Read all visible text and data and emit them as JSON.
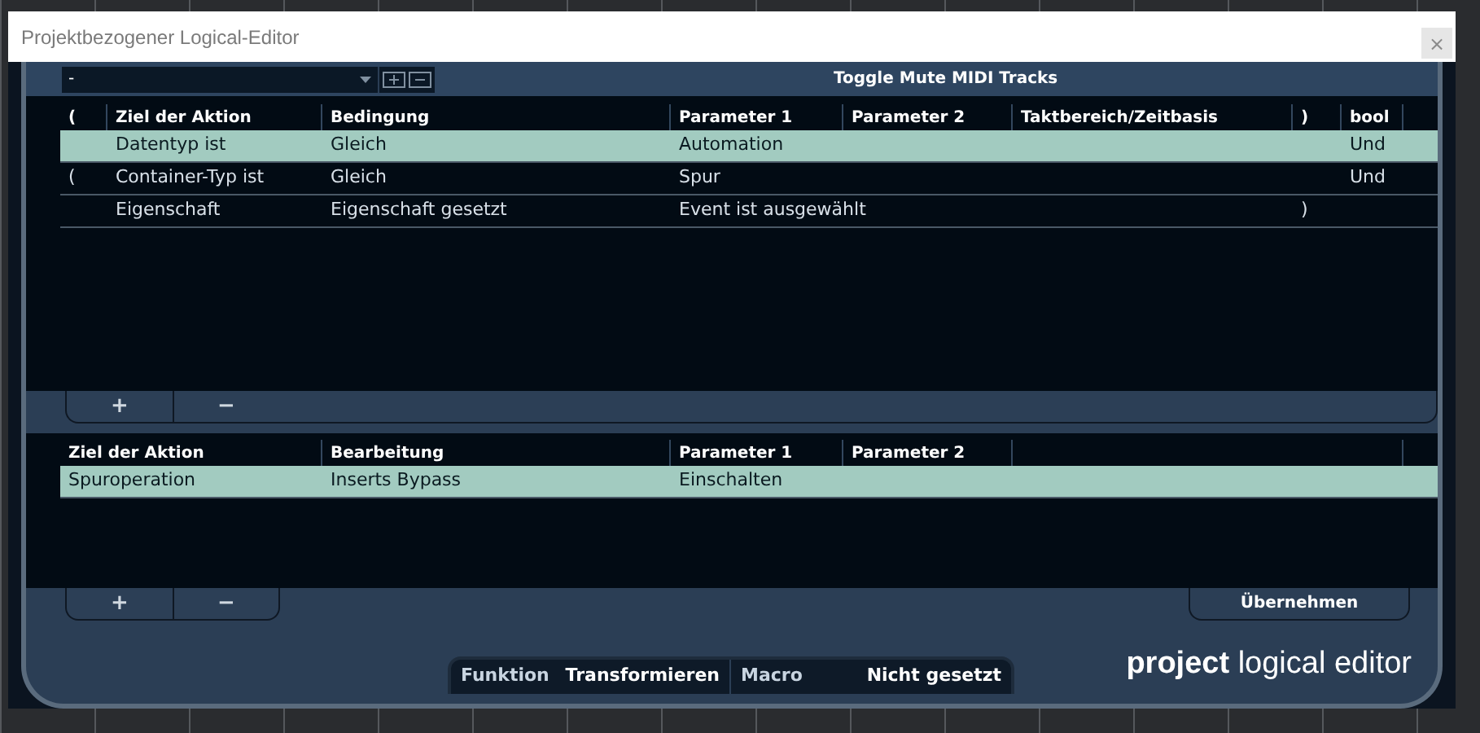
{
  "window": {
    "title": "Projektbezogener Logical-Editor",
    "close": "×"
  },
  "preset": {
    "value": "-",
    "name": "Toggle Mute MIDI Tracks"
  },
  "filter_table": {
    "columns": [
      "(",
      "Ziel der Aktion",
      "Bedingung",
      "Parameter 1",
      "Parameter 2",
      "Taktbereich/Zeitbasis",
      ")",
      "bool"
    ],
    "rows": [
      {
        "selected": true,
        "target": "Datentyp ist",
        "condition": "Gleich",
        "parameter_1": "Automation",
        "bool": "Und"
      },
      {
        "selected": false,
        "open_bracket": "(",
        "target": "Container-Typ ist",
        "condition": "Gleich",
        "parameter_1": "Spur",
        "bool": "Und"
      },
      {
        "selected": false,
        "target": "Eigenschaft",
        "condition": "Eigenschaft gesetzt",
        "parameter_1": "Event ist ausgewählt",
        "close_bracket": ")"
      }
    ]
  },
  "filter_buttons": [
    "+",
    "−"
  ],
  "action_table": {
    "columns": [
      "Ziel der Aktion",
      "Bearbeitung",
      "Parameter 1",
      "Parameter 2"
    ],
    "rows": [
      {
        "selected": true,
        "target": "Spuroperation",
        "operation": "Inserts Bypass",
        "parameter_1": "Einschalten"
      }
    ]
  },
  "action_buttons": [
    "+",
    "−"
  ],
  "apply_button": "Übernehmen",
  "function": {
    "label": "Funktion",
    "value": "Transformieren"
  },
  "macro": {
    "label": "Macro",
    "value": "Nicht gesetzt"
  },
  "logo": "**project** logical editor"
}
